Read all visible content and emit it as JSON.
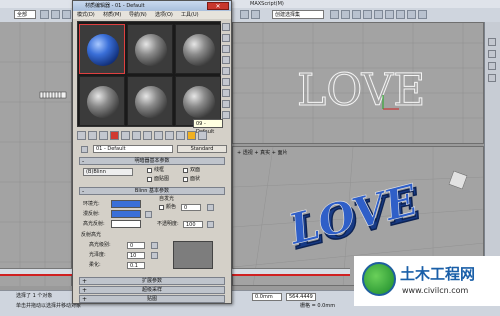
{
  "menubar": {
    "items": [
      "MAXScript(M)"
    ]
  },
  "toolbar": {
    "select_filter": "全部",
    "named_selection_placeholder": "创建选择集"
  },
  "viewports": {
    "top_label": "",
    "persp_label": "+ 透视 + 真实 + 面片",
    "text_top": "LOVE",
    "text_persp": "LOVE"
  },
  "material_editor": {
    "title": "材质编辑器 - 01 - Default",
    "menu": [
      "模式(D)",
      "材质(M)",
      "导航(N)",
      "选项(O)",
      "工具(U)"
    ],
    "tooltip": "09 - Default",
    "material_name": "01 - Default",
    "material_type": "Standard",
    "rollouts": {
      "shader_basic": "明暗器基本参数",
      "blinn_basic": "Blinn 基本参数",
      "extended": "扩展参数",
      "supersampling": "超级采样",
      "maps": "贴图"
    },
    "shader": {
      "type": "(B)Blinn",
      "wire": "线框",
      "two_sided": "双面",
      "face_map": "面贴图",
      "faceted": "面状"
    },
    "blinn": {
      "self_illum_group": "自发光",
      "color_label": "颜色",
      "color_value": "0",
      "ambient": "环境光:",
      "diffuse": "漫反射:",
      "specular": "高光反射:",
      "opacity_label": "不透明度:",
      "opacity_value": "100",
      "specular_highlights": "反射高光",
      "spec_level": "高光级别:",
      "spec_level_value": "0",
      "glossiness": "光泽度:",
      "glossiness_value": "10",
      "soften": "柔化:",
      "soften_value": "0.1"
    }
  },
  "status": {
    "selection": "选择了 1 个对象",
    "hint": "单击并拖动以选择并移动对象",
    "x_value": "0.0mm",
    "z_value": "564.4449",
    "grid": "栅格 = 0.0mm",
    "add_time_tag": "添加时间标记"
  },
  "watermark": {
    "title": "土木工程网",
    "url": "www.civilcn.com"
  },
  "colors": {
    "ambient": "#3a6fd8",
    "diffuse": "#3a6fd8",
    "specular": "#ffffff",
    "love_3d": "#2a55b8",
    "timeline_red": "#d02020"
  }
}
